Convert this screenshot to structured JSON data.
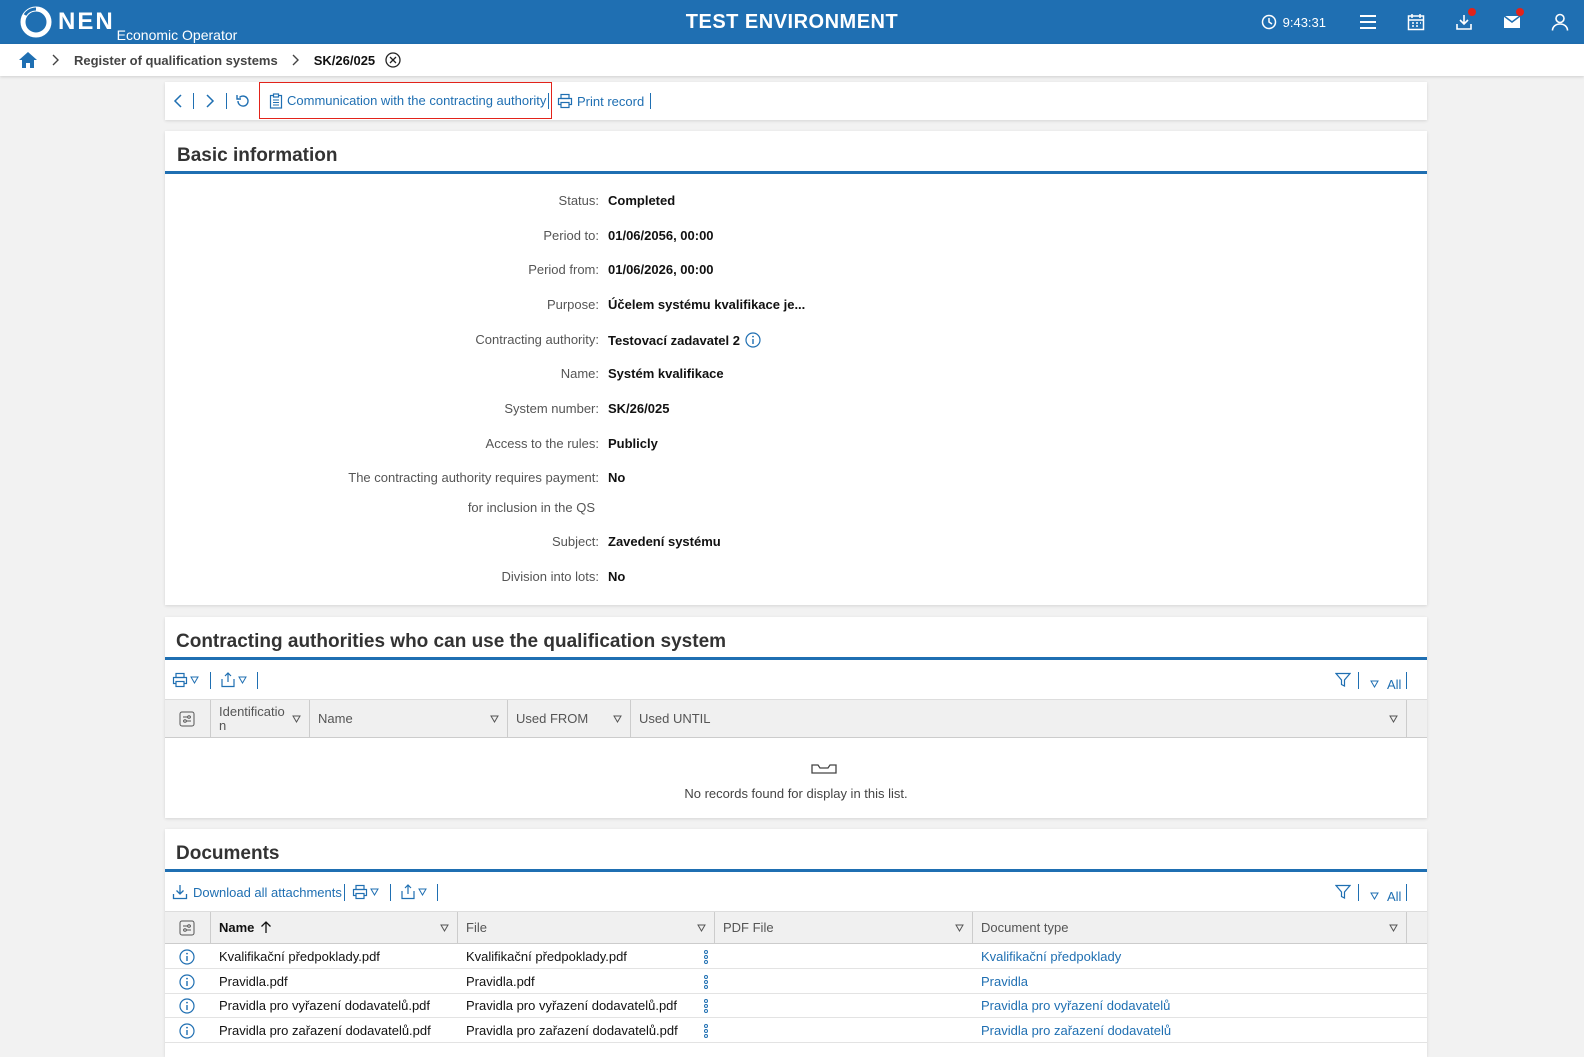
{
  "app": {
    "logo_text": "NEN",
    "logo_subtitle": "Economic Operator",
    "environment": "TEST ENVIRONMENT",
    "time": "9:43:31",
    "icons": [
      "clock-icon",
      "menu-icon",
      "calendar-icon",
      "download-icon",
      "mail-icon",
      "user-icon"
    ]
  },
  "breadcrumb": {
    "items": [
      "Register of qualification systems",
      "SK/26/025"
    ]
  },
  "toolbar": {
    "communication_label": "Communication with the contracting authority",
    "print_label": "Print record"
  },
  "basic_info": {
    "title": "Basic information",
    "fields": [
      {
        "label": "Status:",
        "value": "Completed"
      },
      {
        "label": "Period to:",
        "value": "01/06/2056, 00:00"
      },
      {
        "label": "Period from:",
        "value": "01/06/2026, 00:00"
      },
      {
        "label": "Purpose:",
        "value": "Účelem systému kvalifikace je..."
      },
      {
        "label": "Contracting authority:",
        "value": "Testovací zadavatel 2"
      },
      {
        "label": "Name:",
        "value": "Systém kvalifikace"
      },
      {
        "label": "System number:",
        "value": "SK/26/025"
      },
      {
        "label": "Access to the rules:",
        "value": "Publicly"
      },
      {
        "label": "The contracting authority requires payment:",
        "value": "No"
      },
      {
        "label": "for inclusion in the QS",
        "value": ""
      },
      {
        "label": "Subject:",
        "value": "Zavedení systému"
      },
      {
        "label": "Division into lots:",
        "value": "No"
      }
    ]
  },
  "contracting_authorities": {
    "title": "Contracting authorities who can use the qualification system",
    "filter_all": "All",
    "columns": [
      "Identificatio\nn",
      "Name",
      "Used FROM",
      "Used UNTIL"
    ],
    "empty_message": "No records found for display in this list."
  },
  "documents": {
    "title": "Documents",
    "download_all": "Download all attachments",
    "filter_all": "All",
    "columns": [
      "Name",
      "File",
      "PDF File",
      "Document type"
    ],
    "rows": [
      {
        "name": "Kvalifikační předpoklady.pdf",
        "file": "Kvalifikační předpoklady.pdf",
        "pdf": "",
        "type": "Kvalifikační předpoklady"
      },
      {
        "name": "Pravidla.pdf",
        "file": "Pravidla.pdf",
        "pdf": "",
        "type": "Pravidla"
      },
      {
        "name": "Pravidla pro vyřazení dodavatelů.pdf",
        "file": "Pravidla pro vyřazení dodavatelů.pdf",
        "pdf": "",
        "type": "Pravidla pro vyřazení dodavatelů"
      },
      {
        "name": "Pravidla pro zařazení dodavatelů.pdf",
        "file": "Pravidla pro zařazení dodavatelů.pdf",
        "pdf": "",
        "type": "Pravidla pro zařazení dodavatelů"
      }
    ]
  },
  "colors": {
    "brand_blue": "#1f6fb2",
    "alert_red": "#e2231a"
  }
}
